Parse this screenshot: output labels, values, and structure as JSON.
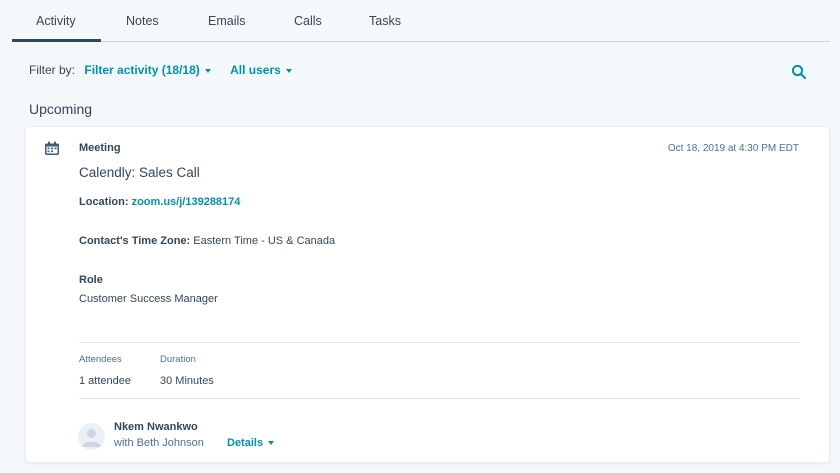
{
  "tabs": [
    {
      "label": "Activity",
      "active": true
    },
    {
      "label": "Notes",
      "active": false
    },
    {
      "label": "Emails",
      "active": false
    },
    {
      "label": "Calls",
      "active": false
    },
    {
      "label": "Tasks",
      "active": false
    }
  ],
  "filter": {
    "label": "Filter by:",
    "activity_filter": "Filter activity (18/18)",
    "users_filter": "All users",
    "search_icon": "search-icon"
  },
  "section": {
    "title": "Upcoming"
  },
  "card": {
    "icon": "calendar-icon",
    "type": "Meeting",
    "timestamp": "Oct 18, 2019 at 4:30 PM EDT",
    "title": "Calendly: Sales Call",
    "location_label": "Location:",
    "location_value": "zoom.us/j/139288174",
    "timezone_label": "Contact's Time Zone:",
    "timezone_value": "Eastern Time - US & Canada",
    "role_label": "Role",
    "role_value": "Customer Success Manager",
    "attendees_label": "Attendees",
    "attendees_value": "1 attendee",
    "duration_label": "Duration",
    "duration_value": "30 Minutes",
    "owner_name": "Nkem Nwankwo",
    "owner_with": "with Beth Johnson",
    "details_label": "Details"
  },
  "colors": {
    "accent": "#0091ae",
    "text": "#33475b",
    "muted": "#516f90",
    "background": "#f5f8fa"
  }
}
